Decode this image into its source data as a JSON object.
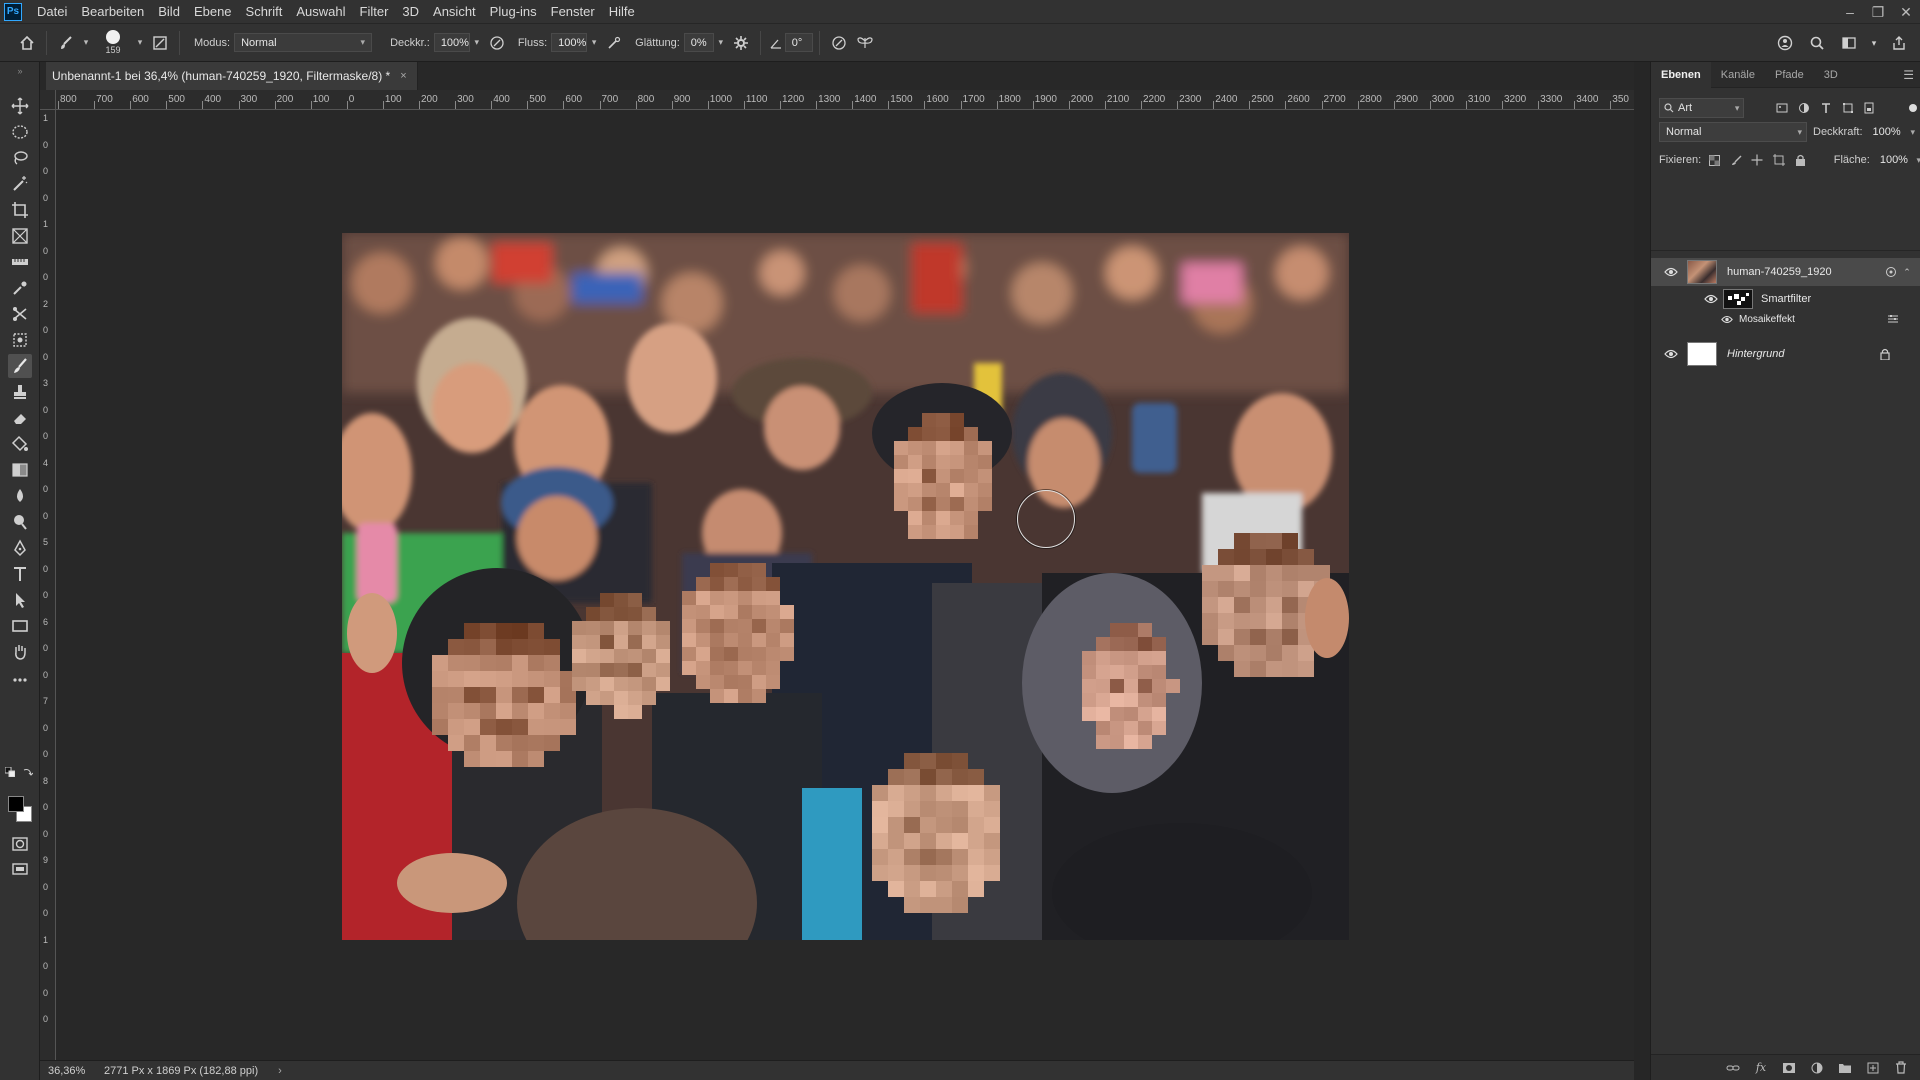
{
  "app": {
    "logo": "Ps"
  },
  "menu": [
    "Datei",
    "Bearbeiten",
    "Bild",
    "Ebene",
    "Schrift",
    "Auswahl",
    "Filter",
    "3D",
    "Ansicht",
    "Plug-ins",
    "Fenster",
    "Hilfe"
  ],
  "window_controls": {
    "minimize": "–",
    "restore": "❐",
    "close": "✕"
  },
  "options": {
    "brush_size": "159",
    "mode_label": "Modus:",
    "mode_value": "Normal",
    "opacity_label": "Deckkr.:",
    "opacity_value": "100%",
    "flow_label": "Fluss:",
    "flow_value": "100%",
    "smoothing_label": "Glättung:",
    "smoothing_value": "0%",
    "angle_value": "0°"
  },
  "document": {
    "tab_title": "Unbenannt-1 bei 36,4% (human-740259_1920, Filtermaske/8) *",
    "tab_close": "×"
  },
  "ruler_h": [
    "800",
    "700",
    "600",
    "500",
    "400",
    "300",
    "200",
    "100",
    "0",
    "100",
    "200",
    "300",
    "400",
    "500",
    "600",
    "700",
    "800",
    "900",
    "1000",
    "1100",
    "1200",
    "1300",
    "1400",
    "1500",
    "1600",
    "1700",
    "1800",
    "1900",
    "2000",
    "2100",
    "2200",
    "2300",
    "2400",
    "2500",
    "2600",
    "2700",
    "2800",
    "2900",
    "3000",
    "3100",
    "3200",
    "3300",
    "3400",
    "350"
  ],
  "ruler_v": [
    "1",
    "0",
    "0",
    "0",
    "1",
    "0",
    "0",
    "2",
    "0",
    "0",
    "3",
    "0",
    "0",
    "4",
    "0",
    "0",
    "5",
    "0",
    "0",
    "6",
    "0",
    "0",
    "7",
    "0",
    "0",
    "8",
    "0",
    "0",
    "9",
    "0",
    "0",
    "1",
    "0",
    "0",
    "0"
  ],
  "status": {
    "zoom": "36,36%",
    "doc_info": "2771 Px x 1869 Px (182,88 ppi)",
    "arrow": "›"
  },
  "panel": {
    "tabs": [
      "Ebenen",
      "Kanäle",
      "Pfade",
      "3D"
    ],
    "filter_kind": "Art",
    "blend_mode": "Normal",
    "opacity_label": "Deckkraft:",
    "opacity_value": "100%",
    "lock_label": "Fixieren:",
    "fill_label": "Fläche:",
    "fill_value": "100%",
    "layers": [
      {
        "name": "human-740259_1920"
      },
      {
        "name": "Smartfilter"
      },
      {
        "name": "Mosaikeffekt"
      },
      {
        "name": "Hintergrund"
      }
    ]
  }
}
